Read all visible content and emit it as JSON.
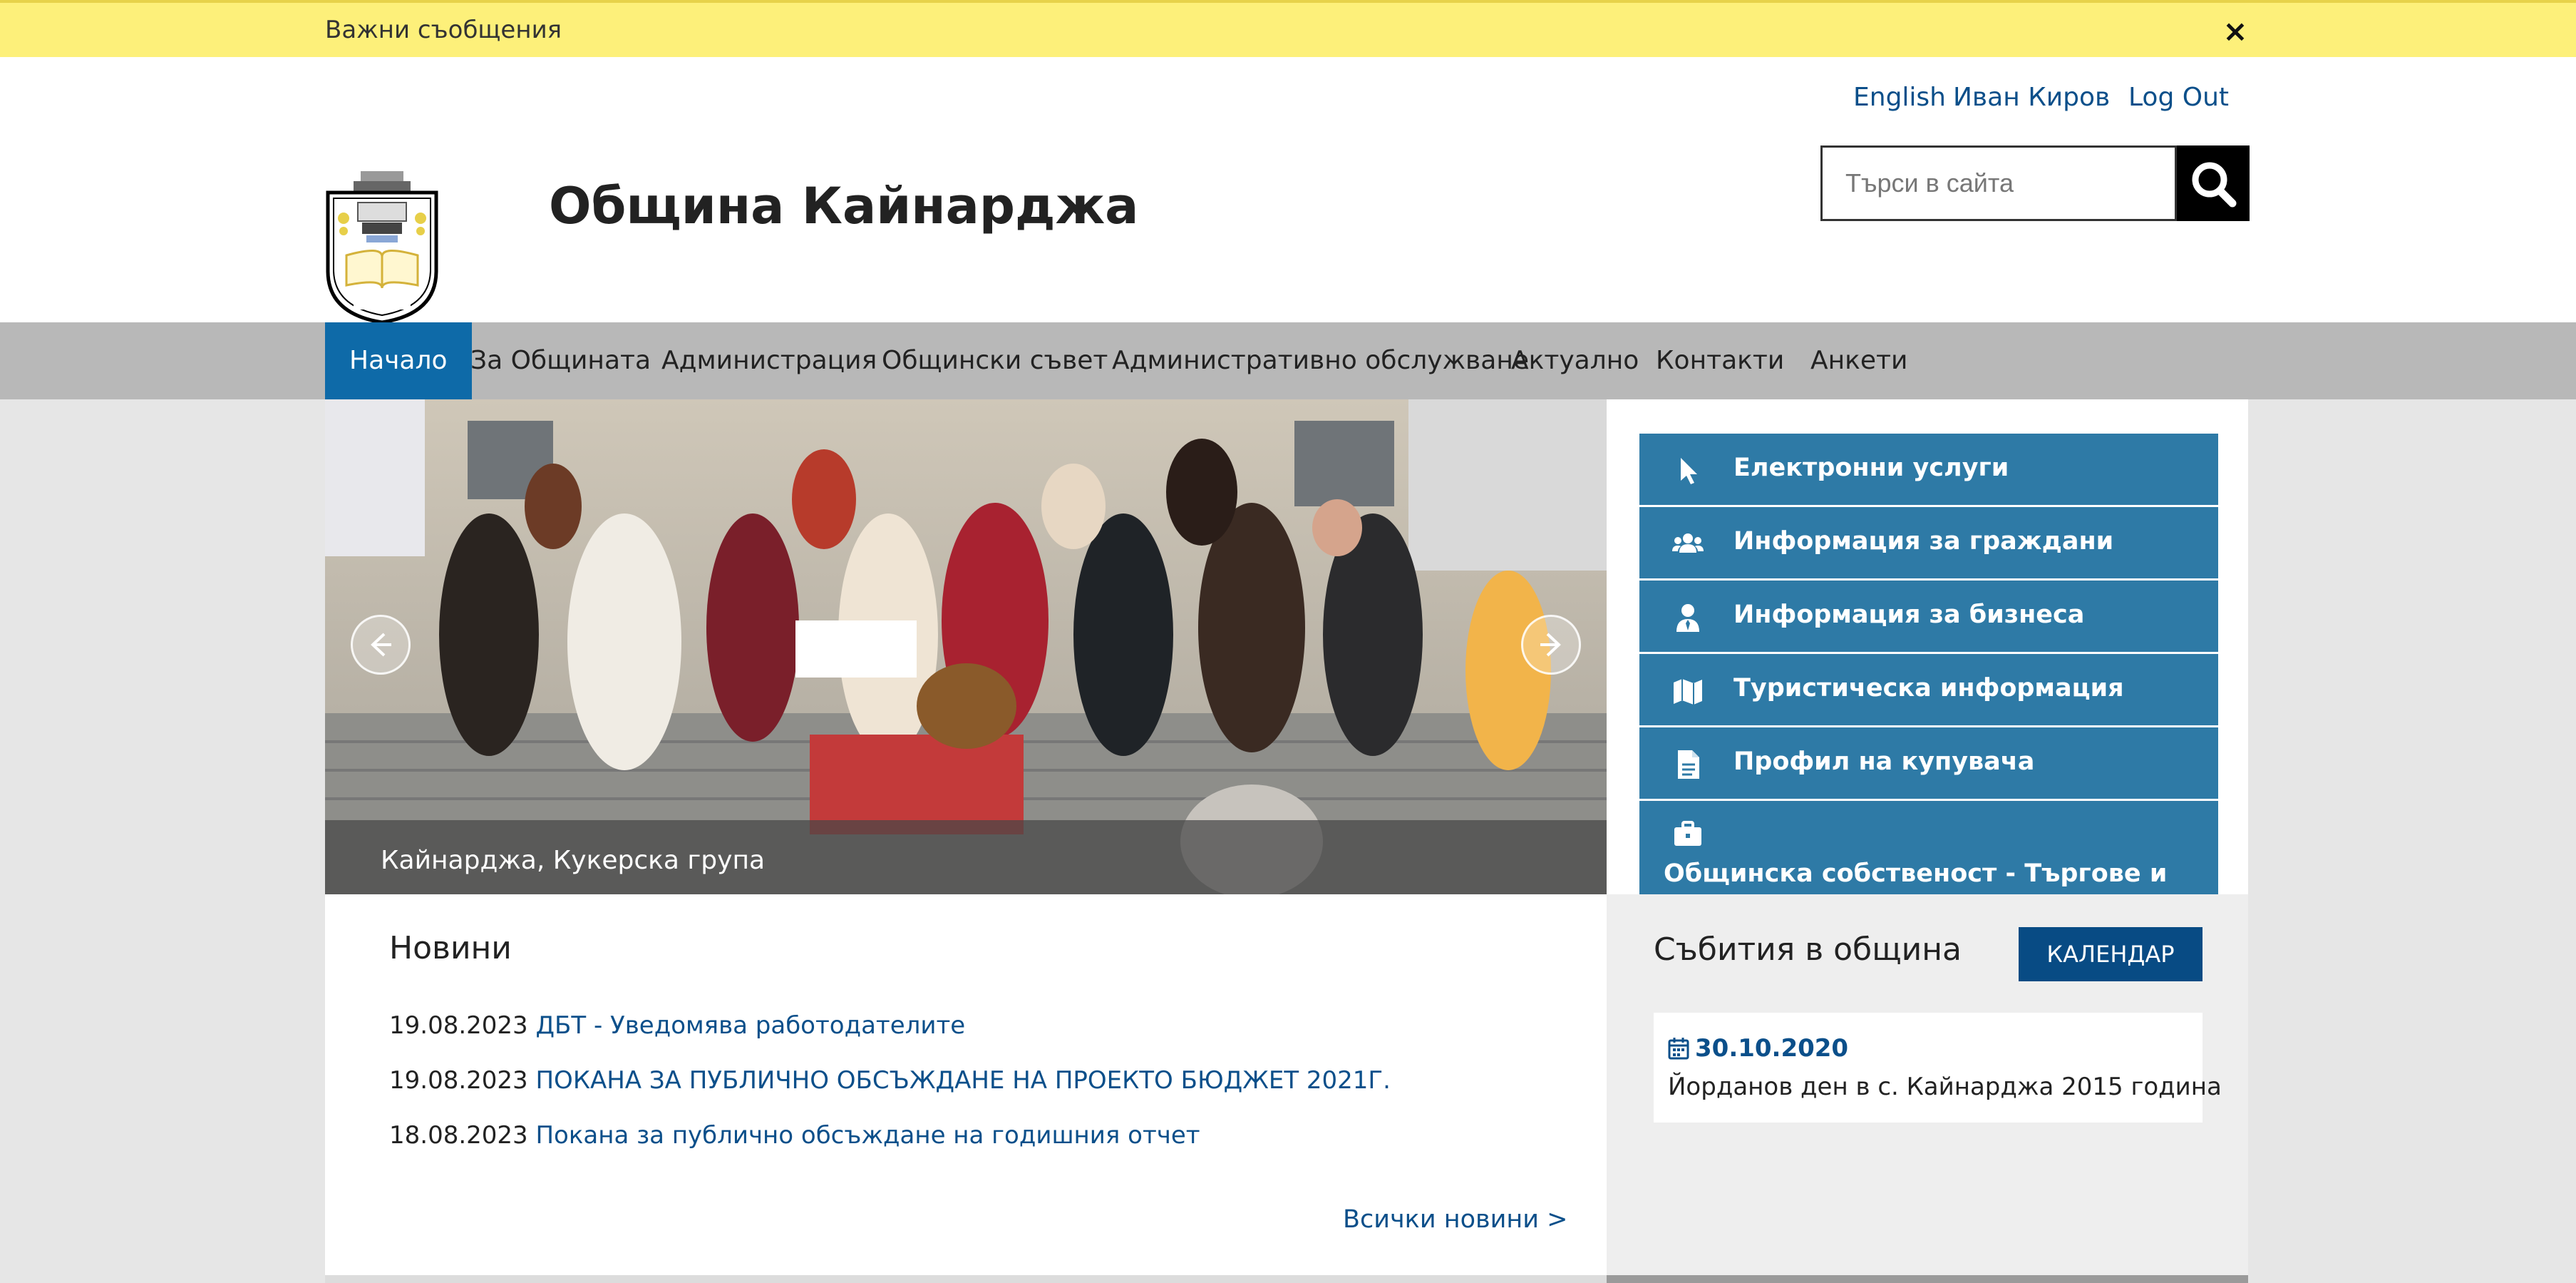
{
  "notice": {
    "text": "Важни съобщения",
    "close": "×"
  },
  "header": {
    "links": {
      "english": "English",
      "user": "Иван Киров",
      "logout": "Log Out"
    },
    "title": "Община Кайнарджа",
    "search_placeholder": "Търси в сайта"
  },
  "nav": {
    "items": [
      {
        "label": "Начало",
        "active": true
      },
      {
        "label": "За Общината"
      },
      {
        "label": "Администрация"
      },
      {
        "label": "Общински съвет"
      },
      {
        "label": "Административно обслужване"
      },
      {
        "label": "Актуално"
      },
      {
        "label": "Контакти"
      },
      {
        "label": "Анкети"
      }
    ]
  },
  "slider": {
    "caption": "Кайнарджа, Кукерска група"
  },
  "side_menu": {
    "items": [
      {
        "label": "Електронни услуги",
        "icon": "cursor-icon"
      },
      {
        "label": "Информация за граждани",
        "icon": "users-icon"
      },
      {
        "label": "Информация за бизнеса",
        "icon": "business-user-icon"
      },
      {
        "label": "Туристическа информация",
        "icon": "map-icon"
      },
      {
        "label": "Профил на купувача",
        "icon": "document-icon"
      },
      {
        "label": "Общинска собственост - Търгове и",
        "icon": "briefcase-icon"
      }
    ]
  },
  "news": {
    "title": "Новини",
    "items": [
      {
        "date": "19.08.2023",
        "title": "ДБТ - Уведомява работодателите"
      },
      {
        "date": "19.08.2023",
        "title": "ПОКАНА ЗА ПУБЛИЧНО ОБСЪЖДАНЕ НА ПРОЕКТО БЮДЖЕТ 2021Г."
      },
      {
        "date": "18.08.2023",
        "title": "Покана за публично обсъждане на годишния отчет"
      }
    ],
    "all_link": "Всички новини >"
  },
  "events": {
    "title": "Събития в община",
    "calendar_button": "КАЛЕНДАР",
    "items": [
      {
        "date": "30.10.2020",
        "title": "Йорданов ден в с. Кайнарджа 2015 година"
      }
    ]
  },
  "colors": {
    "notice_bg": "#fdf07a",
    "nav_active": "#0e6aa8",
    "side_item": "#2e7aa6",
    "link": "#0b4f8a",
    "calendar_button": "#084b84"
  }
}
